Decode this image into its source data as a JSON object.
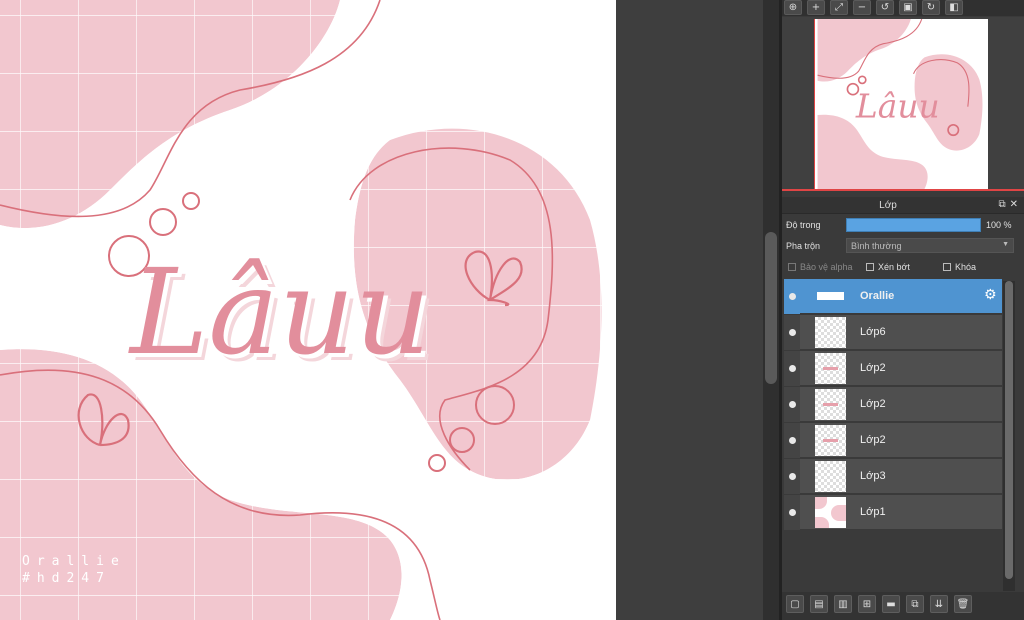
{
  "canvas": {
    "lettering": "Lâuu",
    "signature_line1": "Orallie",
    "signature_line2": "#hd247"
  },
  "navigator": {
    "toolbar_icons": [
      "zoom-fit-icon",
      "zoom-in-icon",
      "fit-screen-icon",
      "zoom-out-icon",
      "rotate-left-icon",
      "fullscreen-icon",
      "rotate-right-icon",
      "flip-icon"
    ]
  },
  "layer_panel": {
    "title": "Lớp",
    "opacity_label": "Độ trong",
    "opacity_value": "100 %",
    "opacity_fraction": 1.0,
    "blend_label": "Pha trộn",
    "blend_value": "Bình thường",
    "protect_alpha_label": "Bảo vệ alpha",
    "clipping_label": "Xén bớt",
    "lock_label": "Khóa",
    "layers": [
      {
        "name": "Orallie",
        "selected": true
      },
      {
        "name": "Lớp6",
        "selected": false
      },
      {
        "name": "Lớp2",
        "selected": false
      },
      {
        "name": "Lớp2",
        "selected": false
      },
      {
        "name": "Lớp2",
        "selected": false
      },
      {
        "name": "Lớp3",
        "selected": false
      },
      {
        "name": "Lớp1",
        "selected": false
      }
    ]
  },
  "colors": {
    "accent": "#4f94d1",
    "pink": "#f1c6ce",
    "line": "#d9707b"
  }
}
